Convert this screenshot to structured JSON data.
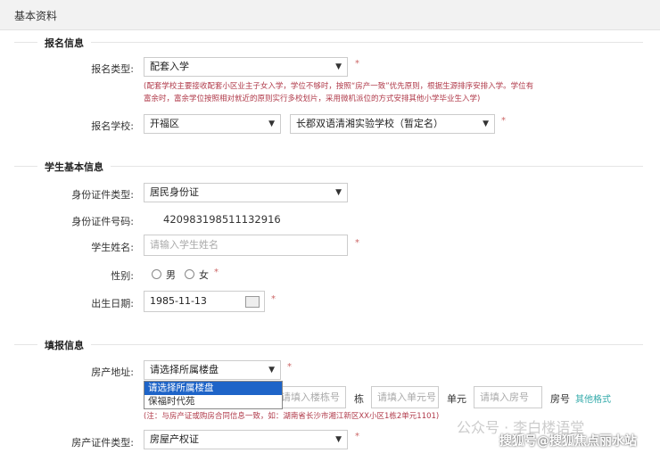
{
  "page_title": "基本资料",
  "sections": {
    "s1": "报名信息",
    "s2": "学生基本信息",
    "s3": "填报信息"
  },
  "reg_type": {
    "label": "报名类型:",
    "value": "配套入学",
    "note1": "(配套学校主要接收配套小区业主子女入学，学位不够时，按照“房产一致”优先原则，根据生源排序安排入学。学位有",
    "note2": "富余时，富余学位按照相对就近的原则实行多校划片，采用微机派位的方式安排其他小学毕业生入学)"
  },
  "reg_school": {
    "label": "报名学校:",
    "district": "开福区",
    "school": "长郡双语清湘实验学校（暂定名）"
  },
  "id_type": {
    "label": "身份证件类型:",
    "value": "居民身份证"
  },
  "id_number": {
    "label": "身份证件号码:",
    "value": "420983198511132916"
  },
  "student_name": {
    "label": "学生姓名:",
    "placeholder": "请输入学生姓名"
  },
  "gender": {
    "label": "性别:",
    "male": "男",
    "female": "女"
  },
  "birth": {
    "label": "出生日期:",
    "value": "1985-11-13"
  },
  "property": {
    "label": "房产地址:",
    "value": "请选择所属楼盘",
    "options": [
      "请选择所属楼盘",
      "保福时代苑"
    ],
    "building_ph": "请填入楼栋号",
    "building_unit": "栋",
    "unit_ph": "请填入单元号",
    "unit_unit": "单元",
    "room_ph": "请填入房号",
    "room_unit": "房号",
    "other_link": "其他格式",
    "note": "(注：与房产证或购房合同信息一致，如：湖南省长沙市湘江新区XX小区1栋2单元1101)"
  },
  "cert_type": {
    "label": "房产证件类型:",
    "value": "房屋产权证"
  },
  "required": "*",
  "watermark1": "公众号 · 李白楼语堂",
  "watermark2": "搜狐号@搜狐焦点丽水站"
}
